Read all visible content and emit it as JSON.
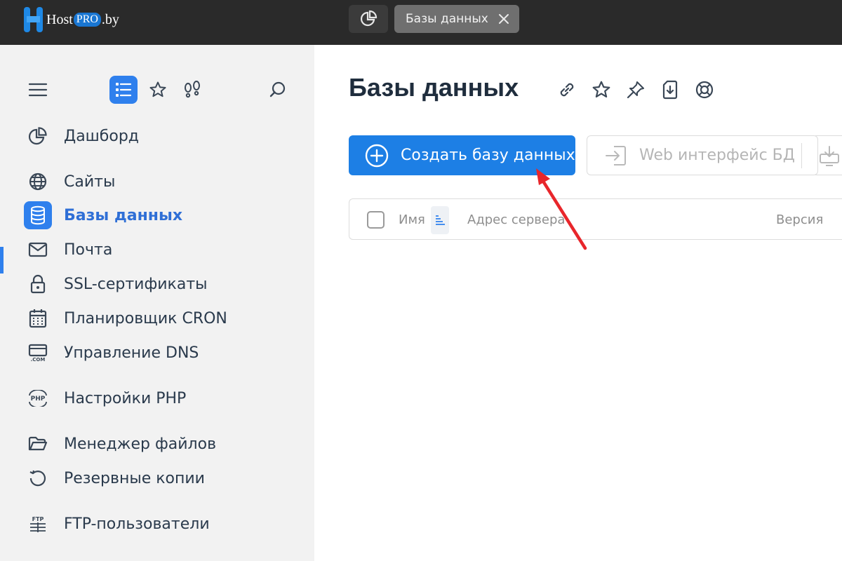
{
  "brand": {
    "prefix": "Host",
    "pro": "PRO",
    "suffix": ".by"
  },
  "tabs": [
    {
      "label": "Базы данных"
    }
  ],
  "sidebar": {
    "items": [
      {
        "label": "Дашборд",
        "icon": "dashboard-pie-icon"
      },
      {
        "label": "Сайты",
        "icon": "globe-icon"
      },
      {
        "label": "Базы данных",
        "icon": "database-icon",
        "active": true
      },
      {
        "label": "Почта",
        "icon": "mail-icon"
      },
      {
        "label": "SSL-сертификаты",
        "icon": "lock-icon"
      },
      {
        "label": "Планировщик CRON",
        "icon": "calendar-icon"
      },
      {
        "label": "Управление DNS",
        "icon": "dns-com-icon"
      },
      {
        "label": "Настройки PHP",
        "icon": "php-icon"
      },
      {
        "label": "Менеджер файлов",
        "icon": "folder-icon"
      },
      {
        "label": "Резервные копии",
        "icon": "backup-icon"
      },
      {
        "label": "FTP-пользователи",
        "icon": "ftp-icon"
      }
    ]
  },
  "main": {
    "title": "Базы данных",
    "create_button": "Создать базу данных",
    "web_button": "Web интерфейс БД",
    "table": {
      "columns": [
        "Имя",
        "Адрес сервера",
        "Версия"
      ]
    }
  },
  "colors": {
    "accent": "#1d7fe5",
    "topbar": "#2a2a2a",
    "sidebar": "#f2f2f2",
    "arrow": "#e8262b"
  }
}
